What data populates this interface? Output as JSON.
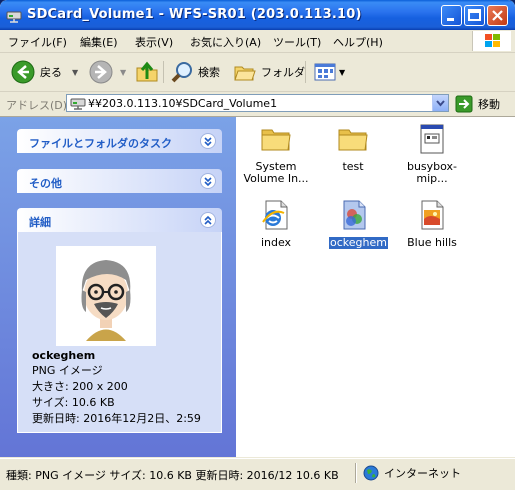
{
  "window": {
    "title": "SDCard_Volume1 - WFS-SR01 (203.0.113.10)",
    "title_color": "#ffffff"
  },
  "menubar": {
    "items": [
      {
        "label": "ファイル(F)"
      },
      {
        "label": "編集(E)"
      },
      {
        "label": "表示(V)"
      },
      {
        "label": "お気に入り(A)"
      },
      {
        "label": "ツール(T)"
      },
      {
        "label": "ヘルプ(H)"
      }
    ]
  },
  "toolbar": {
    "back_label": "戻る",
    "search_label": "検索",
    "folders_label": "フォルダ"
  },
  "address": {
    "label": "アドレス(D)",
    "value": "¥¥203.0.113.10¥SDCard_Volume1",
    "go_label": "移動"
  },
  "taskpane": {
    "panels": [
      {
        "title": "ファイルとフォルダのタスク"
      },
      {
        "title": "その他"
      },
      {
        "title": "詳細"
      }
    ],
    "details": {
      "name": "ockeghem",
      "type": "PNG イメージ",
      "dimensions": "大きさ: 200 x 200",
      "size": "サイズ: 10.6 KB",
      "modified": "更新日時: 2016年12月2日、2:59"
    }
  },
  "files": [
    {
      "name_line1": "System",
      "name_line2": "Volume In...",
      "icon": "folder-icon"
    },
    {
      "name_line1": "test",
      "name_line2": "",
      "icon": "folder-icon"
    },
    {
      "name_line1": "busybox-mip...",
      "name_line2": "",
      "icon": "executable-icon"
    },
    {
      "name_line1": "index",
      "name_line2": "",
      "icon": "html-document-icon"
    },
    {
      "name_line1": "ockeghem",
      "name_line2": "",
      "icon": "png-image-icon",
      "selected": true
    },
    {
      "name_line1": "Blue hills",
      "name_line2": "",
      "icon": "jpeg-image-icon"
    }
  ],
  "statusbar": {
    "text": "種類: PNG イメージ サイズ: 10.6 KB 更新日時: 2016/12 10.6 KB",
    "zone": "インターネット"
  },
  "colors": {
    "titlebar": "#1660e0",
    "taskpane_bg": "#6f8bdc",
    "selection": "#316ac5",
    "panel_title": "#215dc6"
  }
}
